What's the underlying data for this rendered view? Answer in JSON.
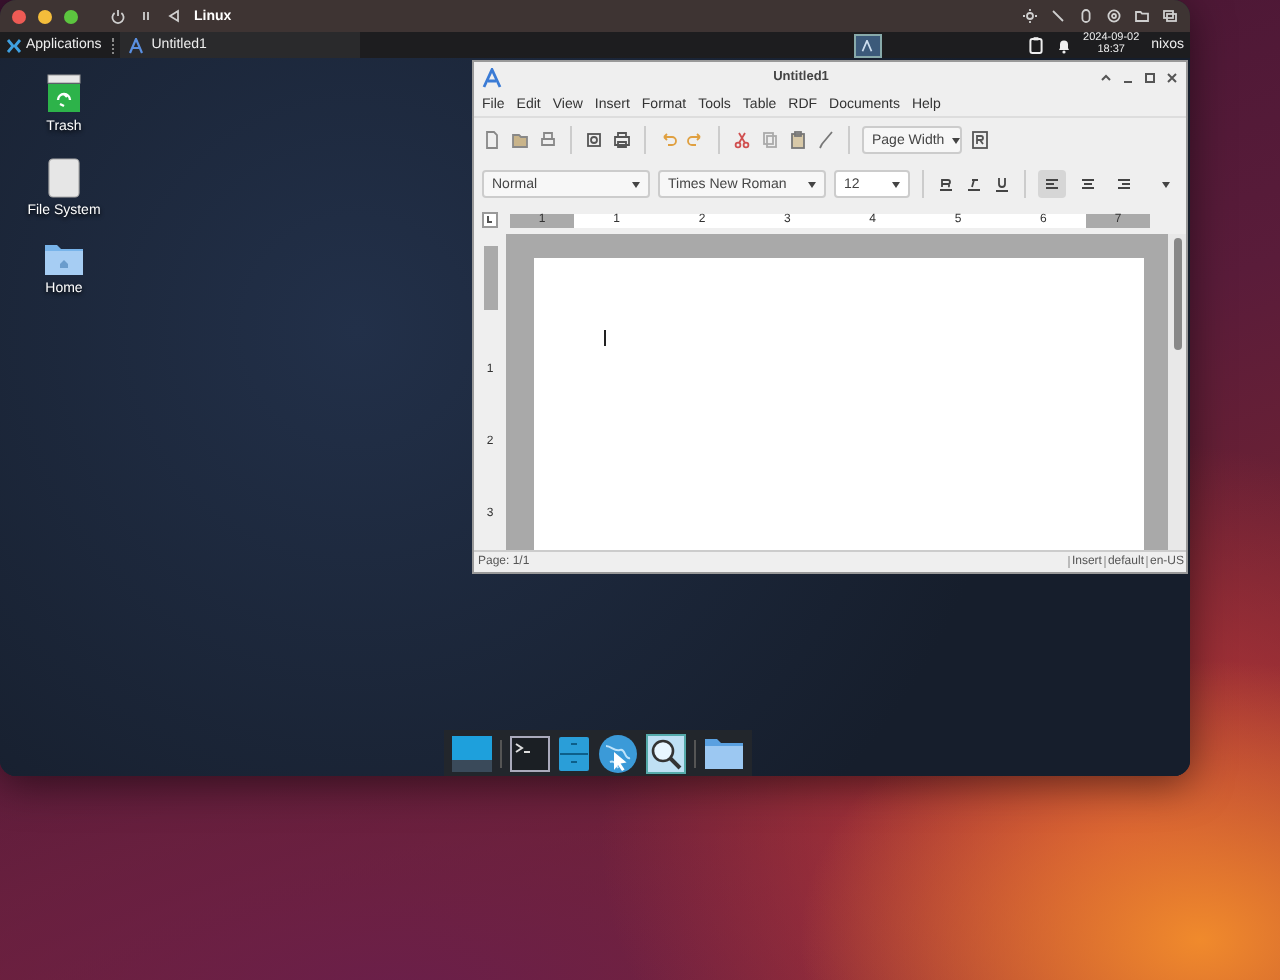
{
  "host_window": {
    "title": "Linux"
  },
  "panel": {
    "applications": "Applications",
    "task": "Untitled1",
    "date": "2024-09-02",
    "time": "18:37",
    "user": "nixos"
  },
  "desktop_icons": [
    {
      "label": "Trash",
      "kind": "trash"
    },
    {
      "label": "File System",
      "kind": "drive"
    },
    {
      "label": "Home",
      "kind": "folder"
    }
  ],
  "app": {
    "title": "Untitled1",
    "menu": [
      "File",
      "Edit",
      "View",
      "Insert",
      "Format",
      "Tools",
      "Table",
      "RDF",
      "Documents",
      "Help"
    ],
    "zoom": "Page Width",
    "style": "Normal",
    "font": "Times New Roman",
    "size": "12",
    "align": [
      {
        "kind": "left",
        "selected": true
      },
      {
        "kind": "center",
        "selected": false
      },
      {
        "kind": "right",
        "selected": false
      }
    ],
    "ruler": [
      "1",
      "1",
      "2",
      "3",
      "4",
      "5",
      "6",
      "7"
    ],
    "vruler": [
      "1",
      "2",
      "3"
    ],
    "status": {
      "page": "Page: 1/1",
      "mode": "Insert",
      "style": "default",
      "lang": "en-US"
    }
  },
  "dock": [
    {
      "kind": "desktop"
    },
    {
      "kind": "terminal"
    },
    {
      "kind": "cabinet"
    },
    {
      "kind": "browser"
    },
    {
      "kind": "search"
    },
    {
      "kind": "folder"
    }
  ]
}
